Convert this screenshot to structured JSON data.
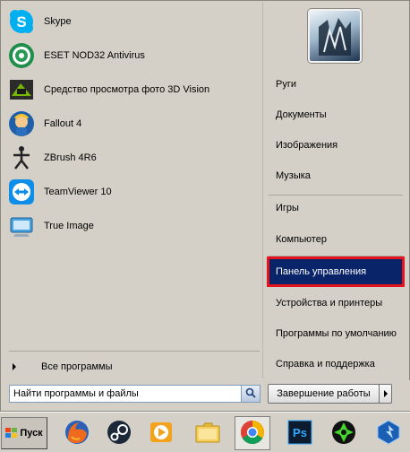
{
  "programs": [
    {
      "label": "Skype",
      "icon": "skype-icon"
    },
    {
      "label": "ESET NOD32 Antivirus",
      "icon": "eset-icon"
    },
    {
      "label": "Средство просмотра фото 3D Vision",
      "icon": "3d-vision-icon"
    },
    {
      "label": "Fallout 4",
      "icon": "fallout-icon"
    },
    {
      "label": "ZBrush 4R6",
      "icon": "zbrush-icon"
    },
    {
      "label": "TeamViewer 10",
      "icon": "teamviewer-icon"
    },
    {
      "label": "True Image",
      "icon": "true-image-icon"
    }
  ],
  "all_programs_label": "Все программы",
  "right_items": [
    {
      "label": "Руги"
    },
    {
      "label": "Документы"
    },
    {
      "label": "Изображения"
    },
    {
      "label": "Музыка"
    },
    {
      "label": "Игры"
    },
    {
      "label": "Компьютер"
    },
    {
      "label": "Панель управления",
      "highlighted": true
    },
    {
      "label": "Устройства и принтеры"
    },
    {
      "label": "Программы по умолчанию"
    },
    {
      "label": "Справка и поддержка"
    }
  ],
  "search": {
    "placeholder": "Найти программы и файлы"
  },
  "shutdown_label": "Завершение работы",
  "taskbar": {
    "start_label": "Пуск",
    "apps": [
      "firefox-icon",
      "steam-icon",
      "media-player-icon",
      "file-explorer-icon",
      "chrome-icon",
      "photoshop-icon",
      "photoshop-icon",
      "razer-icon",
      "heroes-storm-icon"
    ]
  },
  "colors": {
    "highlight_bg": "#0a246a",
    "highlight_border": "#e3141e",
    "menu_bg": "#d4d0c8"
  }
}
